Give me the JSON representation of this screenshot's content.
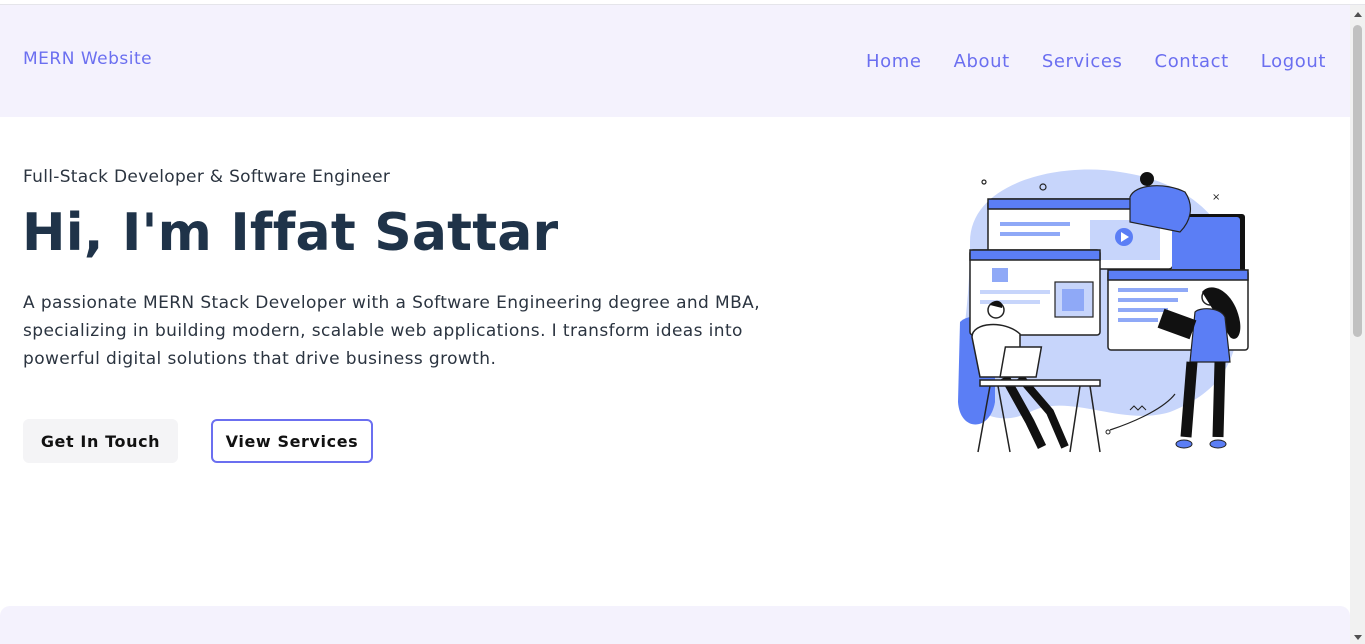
{
  "navbar": {
    "brand": "MERN Website",
    "links": [
      "Home",
      "About",
      "Services",
      "Contact",
      "Logout"
    ]
  },
  "hero": {
    "subtitle": "Full-Stack Developer & Software Engineer",
    "title": "Hi, I'm Iffat Sattar",
    "description": "A passionate MERN Stack Developer with a Software Engineering degree and MBA, specializing in building modern, scalable web applications. I transform ideas into powerful digital solutions that drive business growth.",
    "primary_button": "Get In Touch",
    "secondary_button": "View Services"
  },
  "colors": {
    "accent": "#6b6ff0",
    "nav_bg": "#f4f2fd",
    "heading": "#1f3349",
    "illustration_blue": "#5b7ef5",
    "illustration_light": "#c7d5fb"
  }
}
